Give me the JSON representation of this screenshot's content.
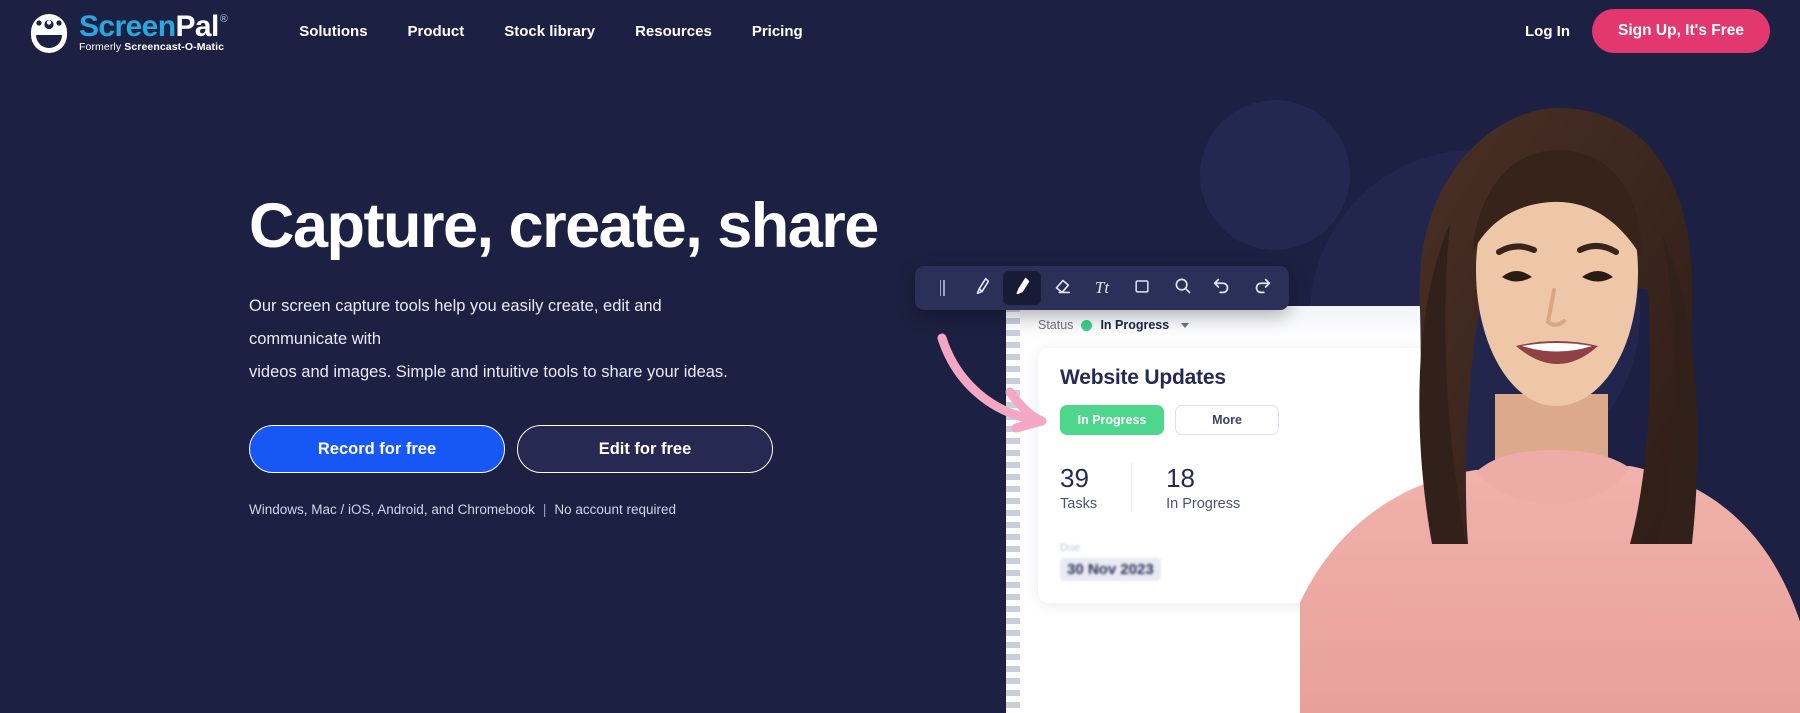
{
  "brand": {
    "logo_icon": "screenpal-face-icon",
    "name_part1": "Screen",
    "name_part2": "Pal",
    "registered": "®",
    "tagline_prefix": "Formerly ",
    "tagline_bold": "Screencast-O-Matic"
  },
  "nav": {
    "items": [
      {
        "label": "Solutions"
      },
      {
        "label": "Product"
      },
      {
        "label": "Stock library"
      },
      {
        "label": "Resources"
      },
      {
        "label": "Pricing"
      }
    ],
    "login_label": "Log In",
    "signup_label": "Sign Up, It's Free"
  },
  "hero": {
    "title": "Capture, create, share",
    "subtitle_line1": "Our screen capture tools help you easily create, edit and communicate with",
    "subtitle_line2": "videos and images. Simple and intuitive tools to share your ideas.",
    "primary_button": "Record for free",
    "secondary_button": "Edit for free",
    "note_platforms": "Windows, Mac / iOS, Android, and Chromebook",
    "note_separator": "|",
    "note_account": "No account required"
  },
  "mockup": {
    "toolbar": [
      {
        "name": "drag-handle",
        "label": "drag"
      },
      {
        "name": "pen-icon",
        "label": "Pen",
        "active": false
      },
      {
        "name": "highlighter-icon",
        "label": "Highlighter",
        "active": true
      },
      {
        "name": "eraser-icon",
        "label": "Eraser",
        "active": false
      },
      {
        "name": "text-icon",
        "label": "Tt",
        "active": false
      },
      {
        "name": "rectangle-icon",
        "label": "Rectangle",
        "active": false
      },
      {
        "name": "zoom-icon",
        "label": "Zoom",
        "active": false
      },
      {
        "name": "undo-icon",
        "label": "Undo",
        "active": false
      },
      {
        "name": "redo-icon",
        "label": "Redo",
        "active": false
      }
    ],
    "status_label": "Status",
    "status_value": "In Progress",
    "panel_heading": "Website Updates",
    "chip_progress": "In Progress",
    "chip_more": "More",
    "stats": [
      {
        "value": "39",
        "label": "Tasks"
      },
      {
        "value": "18",
        "label": "In Progress"
      }
    ],
    "footer_small": "Due",
    "footer_date": "30 Nov 2023"
  },
  "colors": {
    "page_background": "#1c2042",
    "brand_cyan": "#29a8e0",
    "signup_pink": "#e2386f",
    "record_blue": "#1757f5",
    "status_green": "#3cce8a",
    "chip_green": "#4fd68d",
    "annotation_pink": "#f4a7c3"
  }
}
